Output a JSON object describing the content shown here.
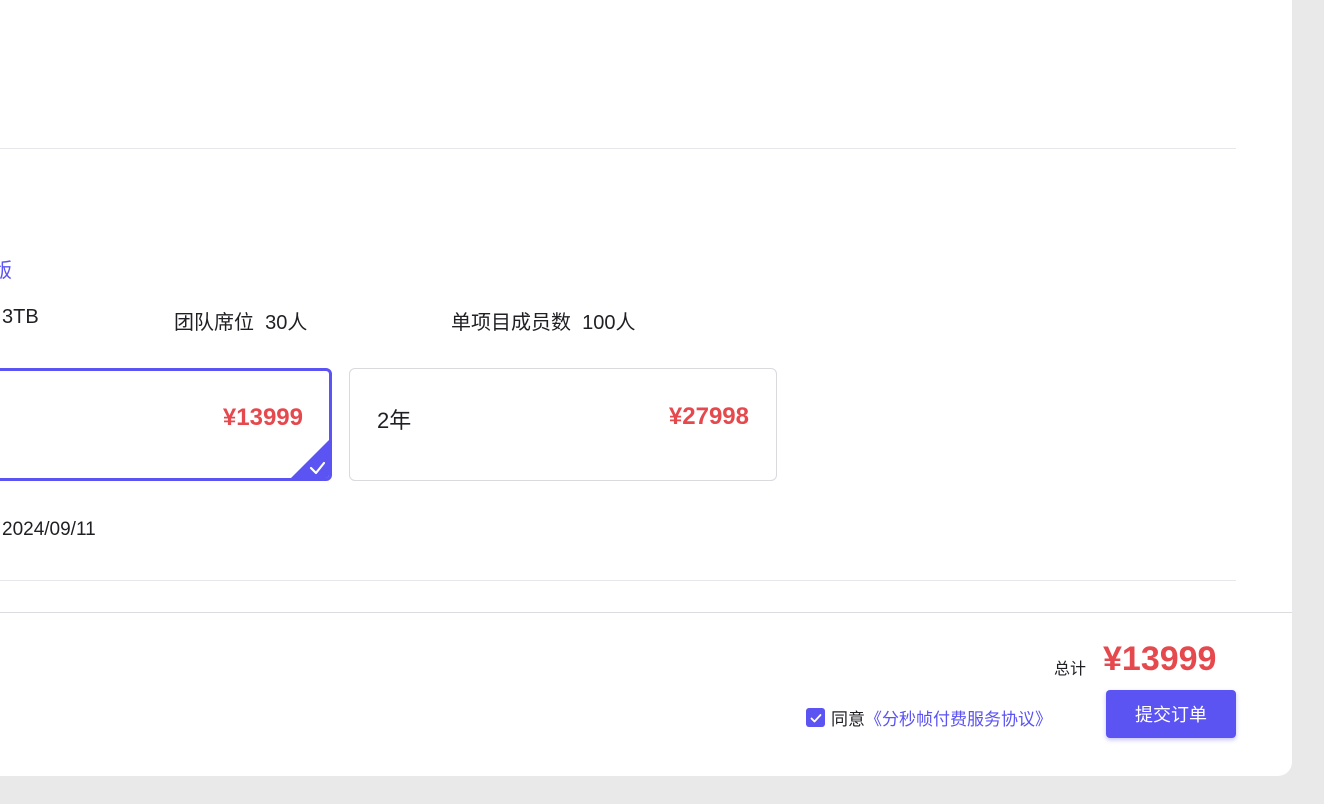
{
  "plan": {
    "name_partial": "版",
    "specs": [
      {
        "text": "3TB"
      },
      {
        "label": "团队席位",
        "value": "30人"
      },
      {
        "label": "单项目成员数",
        "value": "100人"
      }
    ]
  },
  "durations": [
    {
      "label": "",
      "price": "¥13999",
      "selected": true
    },
    {
      "label": "2年",
      "price": "¥27998",
      "selected": false
    }
  ],
  "expire_date": "2024/09/11",
  "footer": {
    "total_label": "总计",
    "total_value": "¥13999",
    "agree_text": "同意",
    "agreement_link": "《分秒帧付费服务协议》",
    "agree_checked": true,
    "submit_label": "提交订单"
  },
  "colors": {
    "accent": "#5b53f2",
    "price": "#e5484d",
    "background": "#e9e9ea"
  }
}
